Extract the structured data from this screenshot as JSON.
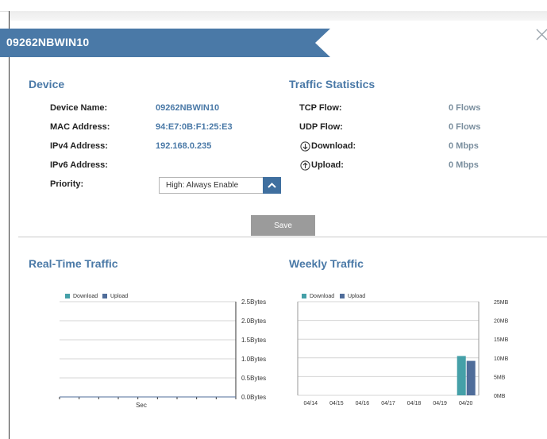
{
  "dialog": {
    "title": "09262NBWIN10",
    "close_icon": "close-x-icon"
  },
  "device": {
    "heading": "Device",
    "fields": [
      {
        "label": "Device Name:",
        "value": "09262NBWIN10"
      },
      {
        "label": "MAC Address:",
        "value": "94:E7:0B:F1:25:E3"
      },
      {
        "label": "IPv4 Address:",
        "value": "192.168.0.235"
      },
      {
        "label": "IPv6 Address:",
        "value": ""
      }
    ],
    "priority": {
      "label": "Priority:",
      "selected": "High: Always Enable",
      "icon": "chevron-up-icon"
    }
  },
  "traffic": {
    "heading": "Traffic Statistics",
    "rows": [
      {
        "label": "TCP Flow:",
        "value": "0 Flows",
        "icon": ""
      },
      {
        "label": "UDP Flow:",
        "value": "0 Flows",
        "icon": ""
      },
      {
        "label": "Download:",
        "value": "0 Mbps",
        "icon": "download-arrow-icon"
      },
      {
        "label": "Upload:",
        "value": "0 Mbps",
        "icon": "upload-arrow-icon"
      }
    ]
  },
  "save_label": "Save",
  "colors": {
    "accent": "#4a79a7",
    "banner": "#4a79a7",
    "download": "#45a0a8",
    "upload": "#4f6d9a"
  },
  "chart_data": [
    {
      "type": "line",
      "title": "Real-Time Traffic",
      "legend": [
        "Download",
        "Upload"
      ],
      "legend_position": "top-left",
      "xlabel": "Sec",
      "ylabel": "",
      "y_ticks": [
        "2.5Bytes",
        "2.0Bytes",
        "1.5Bytes",
        "1.0Bytes",
        "0.5Bytes",
        "0.0Bytes"
      ],
      "ylim": [
        0,
        2.5
      ],
      "grid": true,
      "series": [
        {
          "name": "Download",
          "values": [
            0,
            0,
            0,
            0,
            0,
            0,
            0,
            0,
            0,
            0
          ]
        },
        {
          "name": "Upload",
          "values": [
            0,
            0,
            0,
            0,
            0,
            0,
            0,
            0,
            0,
            0
          ]
        }
      ]
    },
    {
      "type": "bar",
      "title": "Weekly Traffic",
      "legend": [
        "Download",
        "Upload"
      ],
      "legend_position": "top-left",
      "categories": [
        "04/14",
        "04/15",
        "04/16",
        "04/17",
        "04/18",
        "04/19",
        "04/20"
      ],
      "y_ticks": [
        "25MB",
        "20MB",
        "15MB",
        "10MB",
        "5MB",
        "0MB"
      ],
      "ylim": [
        0,
        25
      ],
      "grid": true,
      "series": [
        {
          "name": "Download",
          "values": [
            0,
            0,
            0,
            0,
            0,
            0,
            10.5
          ]
        },
        {
          "name": "Upload",
          "values": [
            0,
            0,
            0,
            0,
            0,
            0,
            9.2
          ]
        }
      ]
    }
  ]
}
